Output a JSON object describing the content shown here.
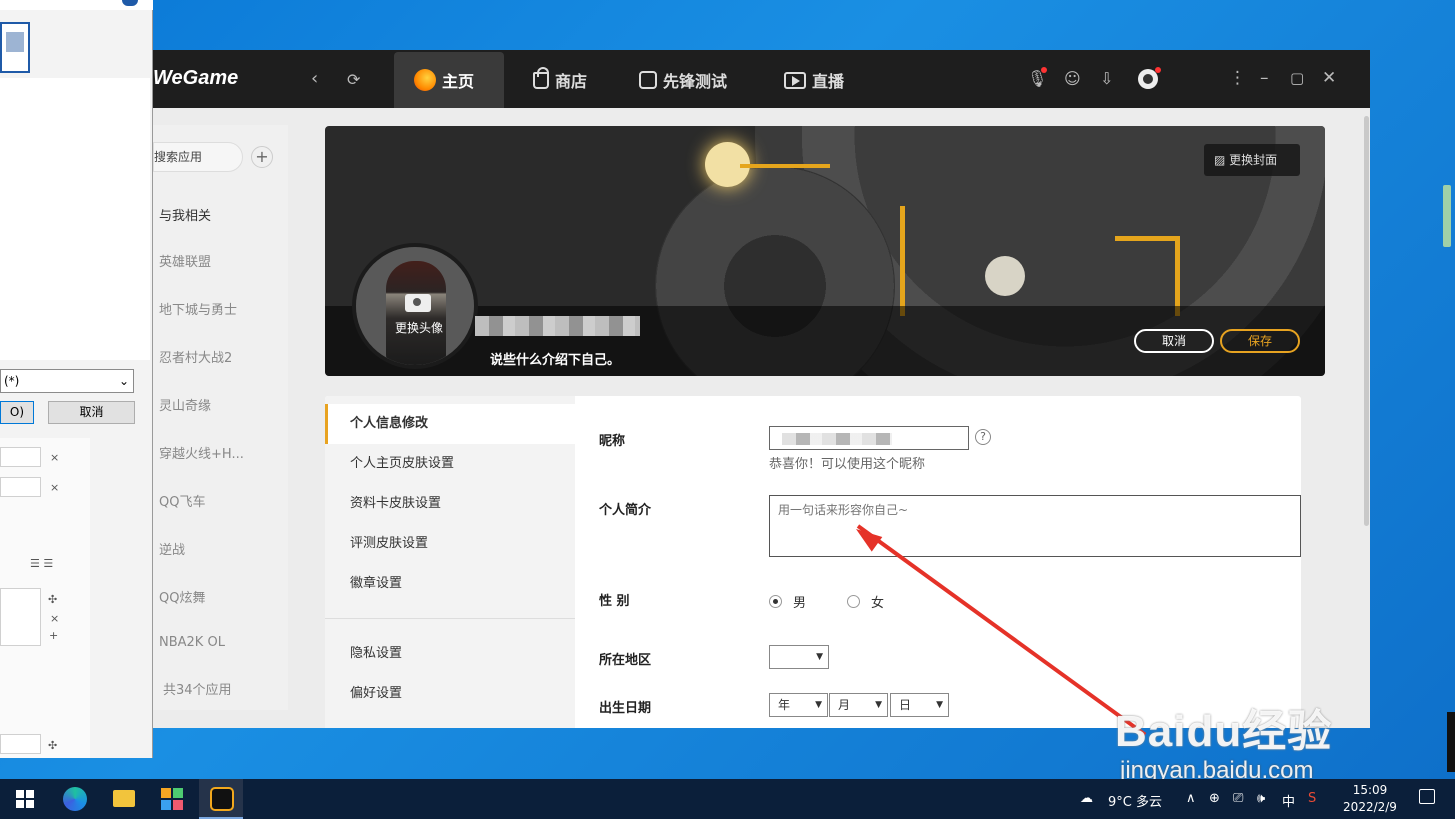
{
  "dialog": {
    "combo_value": "(*)",
    "ok_label": "O)",
    "cancel_label": "取消",
    "x_mark": "×",
    "plus_mark": "+",
    "move_mark": "✣"
  },
  "app": {
    "logo": "WeGame",
    "nav": {
      "back": "‹",
      "refresh": "⟳",
      "tabs": [
        {
          "label": "主页",
          "icon": "home-icon"
        },
        {
          "label": "商店",
          "icon": "shop-icon"
        },
        {
          "label": "先锋测试",
          "icon": "pioneer-test-icon"
        },
        {
          "label": "直播",
          "icon": "live-icon"
        }
      ]
    },
    "window_controls": {
      "menu": "⋮",
      "minimize": "–",
      "maximize": "▢",
      "close": "✕"
    }
  },
  "sidebar": {
    "search_placeholder": "搜索应用",
    "add": "+",
    "items": [
      "与我相关",
      "英雄联盟",
      "地下城与勇士",
      "忍者村大战2",
      "灵山奇缘",
      "穿越火线+H...",
      "QQ飞车",
      "逆战",
      "QQ炫舞",
      "NBA2K OL",
      "共34个应用"
    ]
  },
  "banner": {
    "change_cover": "更换封面",
    "change_avatar": "更换头像",
    "intro": "说些什么介绍下自己。",
    "cancel": "取消",
    "save": "保存"
  },
  "settings_menu": {
    "items": [
      "个人信息修改",
      "个人主页皮肤设置",
      "资料卡皮肤设置",
      "评测皮肤设置",
      "徽章设置",
      "隐私设置",
      "偏好设置"
    ],
    "active_index": 0
  },
  "form": {
    "nickname_label": "昵称",
    "help": "?",
    "nickname_hint": "恭喜你！可以使用这个昵称",
    "bio_label": "个人简介",
    "bio_placeholder": "用一句话来形容你自己~",
    "gender_label": "性 别",
    "gender_male": "男",
    "gender_female": "女",
    "gender_selected": "男",
    "region_label": "所在地区",
    "region_value": "",
    "birth_label": "出生日期",
    "birth_year": "年",
    "birth_month": "月",
    "birth_day": "日"
  },
  "watermark": {
    "logo": "Baidu经验",
    "url": "jingyan.baidu.com"
  },
  "taskbar": {
    "weather": "9°C 多云",
    "tray_expand": "∧",
    "ime": "中",
    "time": "15:09",
    "date": "2022/2/9"
  },
  "colors": {
    "accent_orange": "#e8a321",
    "arrow_red": "#e53228",
    "titlebar": "#1e1e1e"
  }
}
